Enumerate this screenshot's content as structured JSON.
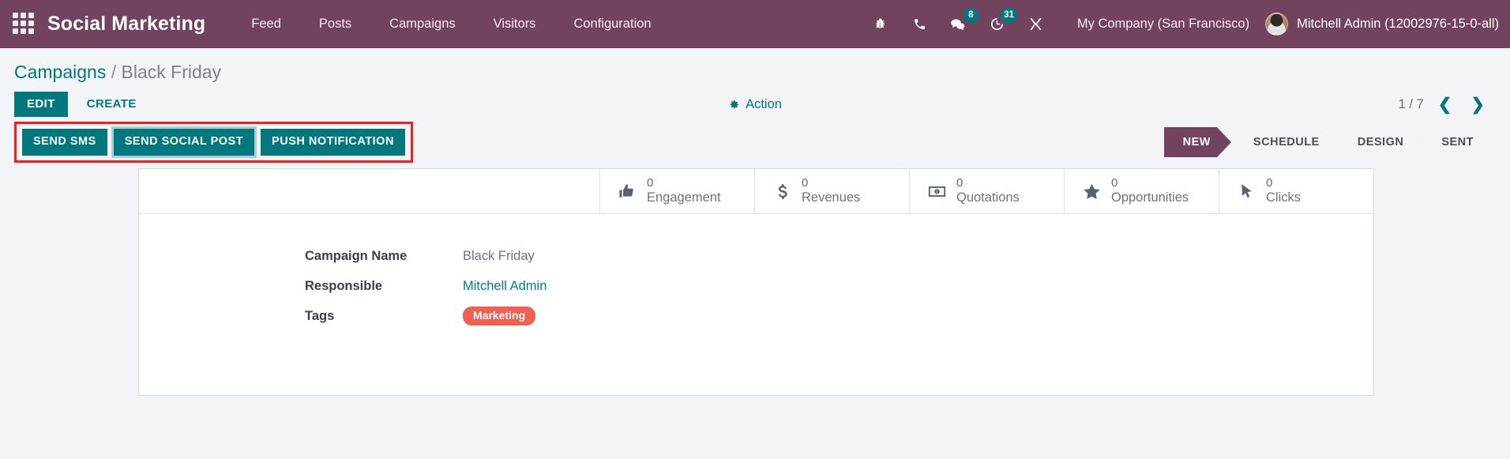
{
  "navbar": {
    "apps_icon": "apps-grid-icon",
    "brand": "Social Marketing",
    "menu": [
      {
        "label": "Feed"
      },
      {
        "label": "Posts"
      },
      {
        "label": "Campaigns"
      },
      {
        "label": "Visitors"
      },
      {
        "label": "Configuration"
      }
    ],
    "sys_icons": [
      {
        "name": "bug-icon",
        "badge": null
      },
      {
        "name": "phone-icon",
        "badge": null
      },
      {
        "name": "messages-icon",
        "badge": "8"
      },
      {
        "name": "activities-clock-icon",
        "badge": "31"
      },
      {
        "name": "tools-icon",
        "badge": null
      }
    ],
    "company": "My Company (San Francisco)",
    "user": "Mitchell Admin (12002976-15-0-all)",
    "colors": {
      "bar": "#71435F",
      "badge": "#00787D"
    }
  },
  "breadcrumb": {
    "root": "Campaigns",
    "separator": "/",
    "current": "Black Friday"
  },
  "control": {
    "edit_label": "EDIT",
    "create_label": "CREATE",
    "action_label": "Action",
    "action_icon": "gear-icon",
    "pager_text": "1 / 7",
    "prev_icon": "❮",
    "next_icon": "❯"
  },
  "action_buttons": {
    "highlight_color": "#FF1A1A",
    "items": [
      {
        "label": "SEND SMS",
        "focused": false
      },
      {
        "label": "SEND SOCIAL POST",
        "focused": true
      },
      {
        "label": "PUSH NOTIFICATION",
        "focused": false
      }
    ]
  },
  "statusbar": {
    "stages": [
      {
        "label": "NEW",
        "active": true
      },
      {
        "label": "SCHEDULE",
        "active": false
      },
      {
        "label": "DESIGN",
        "active": false
      },
      {
        "label": "SENT",
        "active": false
      }
    ],
    "active_color": "#71435F"
  },
  "stat_buttons": [
    {
      "icon": "thumbs-up-icon",
      "value": "0",
      "label": "Engagement"
    },
    {
      "icon": "dollar-sign-icon",
      "value": "0",
      "label": "Revenues"
    },
    {
      "icon": "money-bill-icon",
      "value": "0",
      "label": "Quotations"
    },
    {
      "icon": "star-icon",
      "value": "0",
      "label": "Opportunities"
    },
    {
      "icon": "mouse-pointer-icon",
      "value": "0",
      "label": "Clicks"
    }
  ],
  "form": {
    "fields": [
      {
        "label": "Campaign Name",
        "value": "Black Friday",
        "type": "text"
      },
      {
        "label": "Responsible",
        "value": "Mitchell Admin",
        "type": "link"
      },
      {
        "label": "Tags",
        "value": "Marketing",
        "type": "tag",
        "tag_color": "#F06050"
      }
    ]
  }
}
